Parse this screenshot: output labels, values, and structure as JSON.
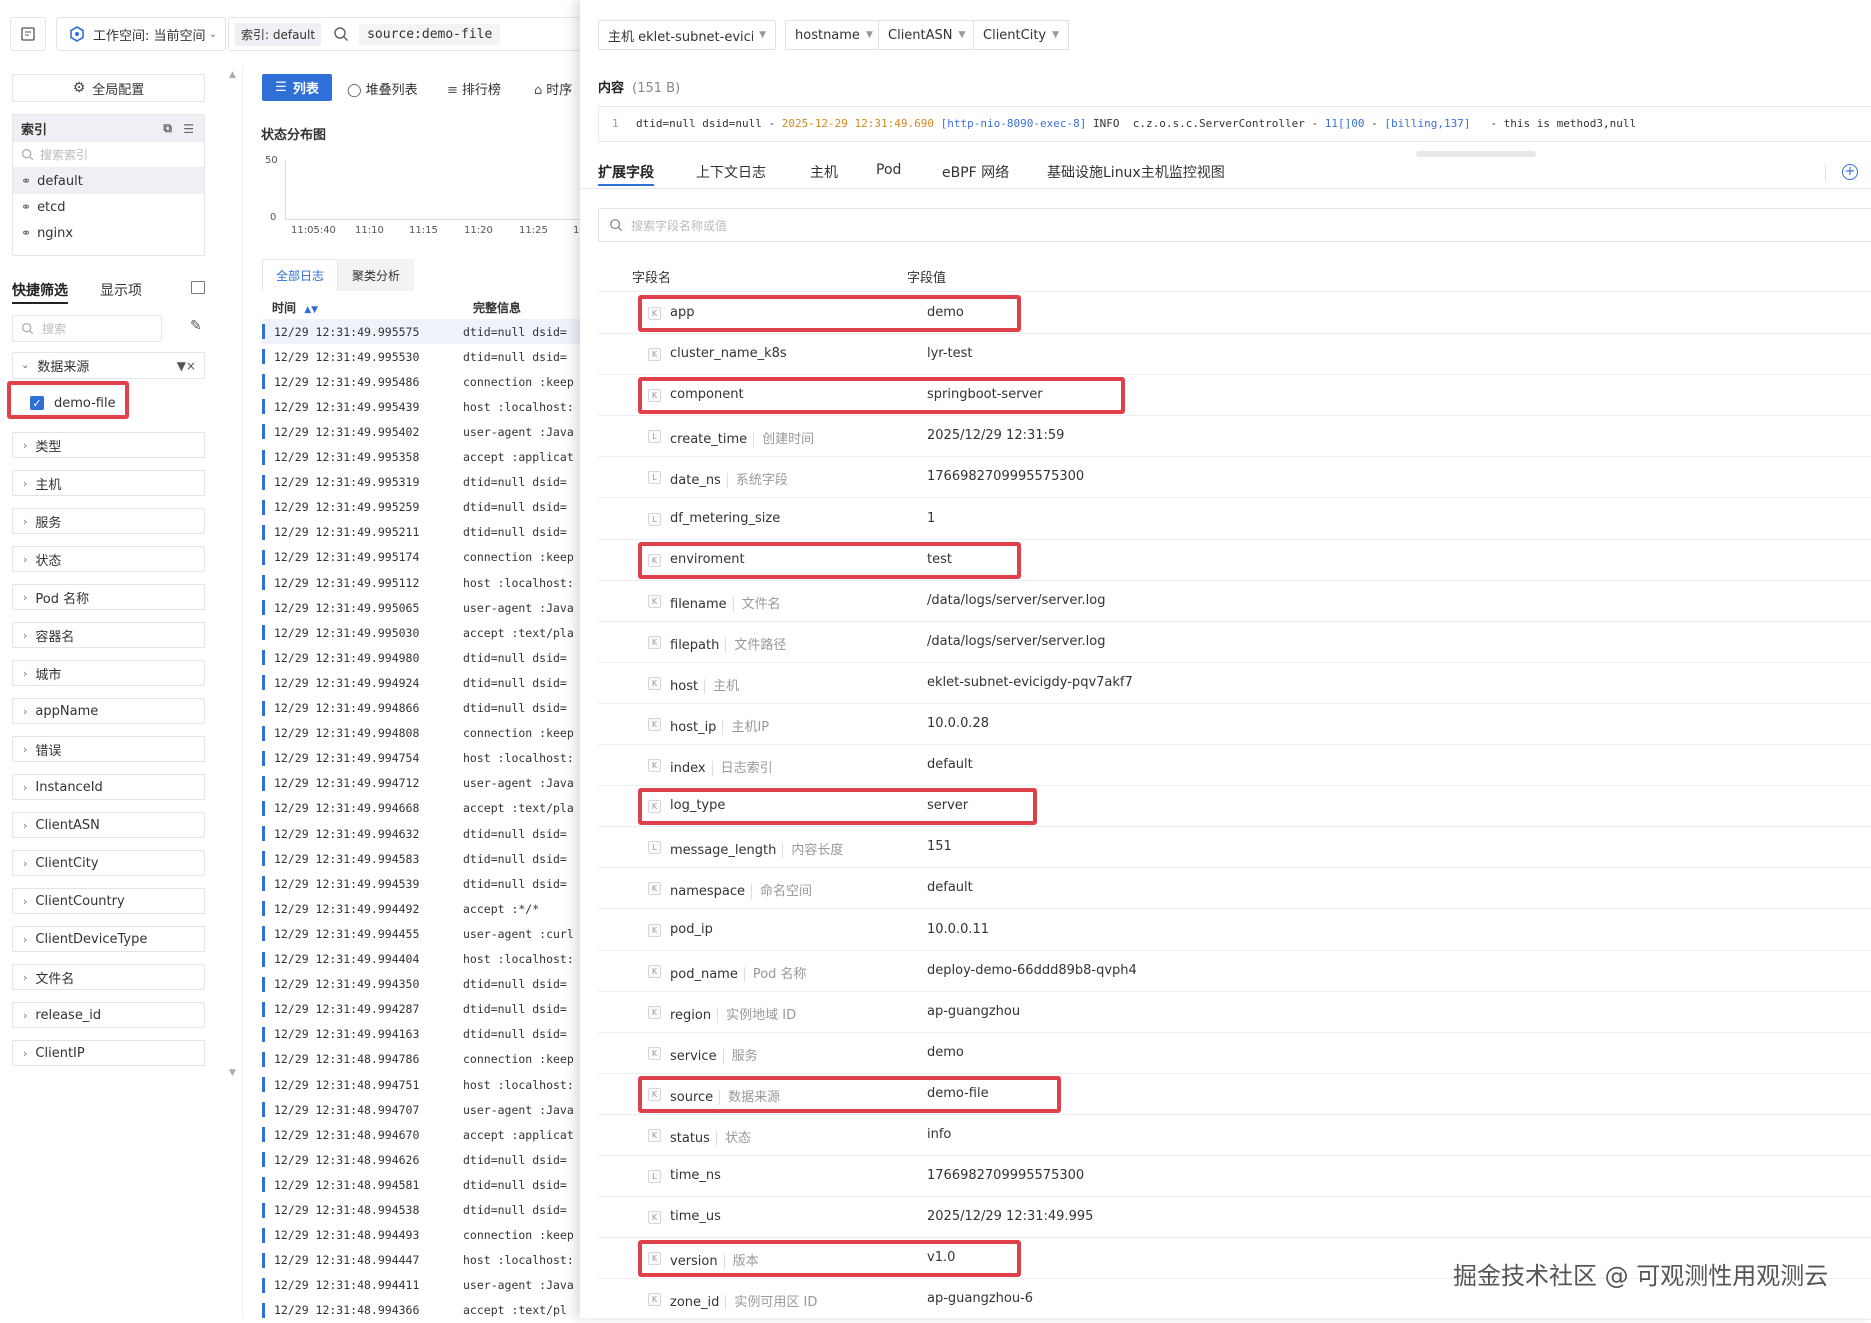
{
  "topbar": {
    "workspace_label": "工作空间: 当前空间",
    "index_chip": "索引: default",
    "query_text": "source:demo-file"
  },
  "sidebar": {
    "global_config": "全局配置",
    "index_title": "索引",
    "index_search_placeholder": "搜索索引",
    "indexes": [
      "default",
      "etcd",
      "nginx"
    ],
    "tab_quick_filter": "快捷筛选",
    "tab_display": "显示项",
    "search_placeholder": "搜索",
    "data_source_label": "数据来源",
    "data_source_value": "demo-file",
    "categories": [
      "类型",
      "主机",
      "服务",
      "状态",
      "Pod 名称",
      "容器名",
      "城市",
      "appName",
      "错误",
      "InstanceId",
      "ClientASN",
      "ClientCity",
      "ClientCountry",
      "ClientDeviceType",
      "文件名",
      "release_id",
      "ClientIP"
    ]
  },
  "middle": {
    "view_tabs": [
      "列表",
      "堆叠列表",
      "排行榜",
      "时序"
    ],
    "status_title": "状态分布图",
    "y_ticks": [
      "50",
      "0"
    ],
    "x_ticks": [
      "11:05:40",
      "11:10",
      "11:15",
      "11:20",
      "11:25",
      "1"
    ],
    "log_tabs": [
      "全部日志",
      "聚类分析"
    ],
    "col_time": "时间",
    "col_msg": "完整信息",
    "rows": [
      {
        "t": "12/29 12:31:49.995575",
        "m": "dtid=null dsid="
      },
      {
        "t": "12/29 12:31:49.995530",
        "m": "dtid=null dsid="
      },
      {
        "t": "12/29 12:31:49.995486",
        "m": "connection :keep"
      },
      {
        "t": "12/29 12:31:49.995439",
        "m": "host :localhost:"
      },
      {
        "t": "12/29 12:31:49.995402",
        "m": "user-agent :Java"
      },
      {
        "t": "12/29 12:31:49.995358",
        "m": "accept :applicat"
      },
      {
        "t": "12/29 12:31:49.995319",
        "m": "dtid=null dsid="
      },
      {
        "t": "12/29 12:31:49.995259",
        "m": "dtid=null dsid="
      },
      {
        "t": "12/29 12:31:49.995211",
        "m": "dtid=null dsid="
      },
      {
        "t": "12/29 12:31:49.995174",
        "m": "connection :keep"
      },
      {
        "t": "12/29 12:31:49.995112",
        "m": "host :localhost:"
      },
      {
        "t": "12/29 12:31:49.995065",
        "m": "user-agent :Java"
      },
      {
        "t": "12/29 12:31:49.995030",
        "m": "accept :text/pla"
      },
      {
        "t": "12/29 12:31:49.994980",
        "m": "dtid=null dsid="
      },
      {
        "t": "12/29 12:31:49.994924",
        "m": "dtid=null dsid="
      },
      {
        "t": "12/29 12:31:49.994866",
        "m": "dtid=null dsid="
      },
      {
        "t": "12/29 12:31:49.994808",
        "m": "connection :keep"
      },
      {
        "t": "12/29 12:31:49.994754",
        "m": "host :localhost:"
      },
      {
        "t": "12/29 12:31:49.994712",
        "m": "user-agent :Java"
      },
      {
        "t": "12/29 12:31:49.994668",
        "m": "accept :text/pla"
      },
      {
        "t": "12/29 12:31:49.994632",
        "m": "dtid=null dsid="
      },
      {
        "t": "12/29 12:31:49.994583",
        "m": "dtid=null dsid="
      },
      {
        "t": "12/29 12:31:49.994539",
        "m": "dtid=null dsid="
      },
      {
        "t": "12/29 12:31:49.994492",
        "m": "accept :*/*"
      },
      {
        "t": "12/29 12:31:49.994455",
        "m": "user-agent :curl"
      },
      {
        "t": "12/29 12:31:49.994404",
        "m": "host :localhost:"
      },
      {
        "t": "12/29 12:31:49.994350",
        "m": "dtid=null dsid="
      },
      {
        "t": "12/29 12:31:49.994287",
        "m": "dtid=null dsid="
      },
      {
        "t": "12/29 12:31:49.994163",
        "m": "dtid=null dsid="
      },
      {
        "t": "12/29 12:31:48.994786",
        "m": "connection :keep"
      },
      {
        "t": "12/29 12:31:48.994751",
        "m": "host :localhost:"
      },
      {
        "t": "12/29 12:31:48.994707",
        "m": "user-agent :Java"
      },
      {
        "t": "12/29 12:31:48.994670",
        "m": "accept :applicat"
      },
      {
        "t": "12/29 12:31:48.994626",
        "m": "dtid=null dsid="
      },
      {
        "t": "12/29 12:31:48.994581",
        "m": "dtid=null dsid="
      },
      {
        "t": "12/29 12:31:48.994538",
        "m": "dtid=null dsid="
      },
      {
        "t": "12/29 12:31:48.994493",
        "m": "connection :keep"
      },
      {
        "t": "12/29 12:31:48.994447",
        "m": "host :localhost:"
      },
      {
        "t": "12/29 12:31:48.994411",
        "m": "user-agent :Java"
      },
      {
        "t": "12/29 12:31:48.994366",
        "m": "accept :text/pl"
      }
    ]
  },
  "panel": {
    "chips": [
      "主机 eklet-subnet-evicigd...",
      "hostname",
      "ClientASN",
      "ClientCity"
    ],
    "content_label": "内容",
    "content_size": "(151 B)",
    "line_no": "1",
    "content_parts": [
      {
        "text": "dtid=null dsid=null - ",
        "color": "#333333"
      },
      {
        "text": "2025-12-29 12:31:49.690",
        "color": "#d08a1e"
      },
      {
        "text": " [http-nio-8090-exec-8]",
        "color": "#3a6fd8"
      },
      {
        "text": " INFO  c.z.o.s.c.ServerController - ",
        "color": "#333333"
      },
      {
        "text": "11[]00",
        "color": "#3a6fd8"
      },
      {
        "text": " - ",
        "color": "#333333"
      },
      {
        "text": "[billing,137]",
        "color": "#3a6fd8"
      },
      {
        "text": "   - this is method3,null",
        "color": "#333333"
      }
    ],
    "tabs": [
      "扩展字段",
      "上下文日志",
      "主机",
      "Pod",
      "eBPF 网络",
      "基础设施Linux主机监控视图"
    ],
    "field_search_placeholder": "搜索字段名称或值",
    "col_name": "字段名",
    "col_value": "字段值",
    "fields": [
      {
        "k": "K",
        "name": "app",
        "desc": "",
        "value": "demo",
        "hl": true
      },
      {
        "k": "K",
        "name": "cluster_name_k8s",
        "desc": "",
        "value": "lyr-test",
        "hl": false
      },
      {
        "k": "K",
        "name": "component",
        "desc": "",
        "value": "springboot-server",
        "hl": true
      },
      {
        "k": "L",
        "name": "create_time",
        "desc": "创建时间",
        "value": "2025/12/29 12:31:59",
        "hl": false
      },
      {
        "k": "L",
        "name": "date_ns",
        "desc": "系统字段",
        "value": "1766982709995575300",
        "hl": false
      },
      {
        "k": "L",
        "name": "df_metering_size",
        "desc": "",
        "value": "1",
        "hl": false
      },
      {
        "k": "K",
        "name": "enviroment",
        "desc": "",
        "value": "test",
        "hl": true
      },
      {
        "k": "K",
        "name": "filename",
        "desc": "文件名",
        "value": "/data/logs/server/server.log",
        "hl": false
      },
      {
        "k": "K",
        "name": "filepath",
        "desc": "文件路径",
        "value": "/data/logs/server/server.log",
        "hl": false
      },
      {
        "k": "K",
        "name": "host",
        "desc": "主机",
        "value": "eklet-subnet-evicigdy-pqv7akf7",
        "hl": false
      },
      {
        "k": "K",
        "name": "host_ip",
        "desc": "主机IP",
        "value": "10.0.0.28",
        "hl": false
      },
      {
        "k": "K",
        "name": "index",
        "desc": "日志索引",
        "value": "default",
        "hl": false
      },
      {
        "k": "K",
        "name": "log_type",
        "desc": "",
        "value": "server",
        "hl": true
      },
      {
        "k": "L",
        "name": "message_length",
        "desc": "内容长度",
        "value": "151",
        "hl": false
      },
      {
        "k": "K",
        "name": "namespace",
        "desc": "命名空间",
        "value": "default",
        "hl": false
      },
      {
        "k": "K",
        "name": "pod_ip",
        "desc": "",
        "value": "10.0.0.11",
        "hl": false
      },
      {
        "k": "K",
        "name": "pod_name",
        "desc": "Pod 名称",
        "value": "deploy-demo-66ddd89b8-qvph4",
        "hl": false
      },
      {
        "k": "K",
        "name": "region",
        "desc": "实例地域 ID",
        "value": "ap-guangzhou",
        "hl": false
      },
      {
        "k": "K",
        "name": "service",
        "desc": "服务",
        "value": "demo",
        "hl": false
      },
      {
        "k": "K",
        "name": "source",
        "desc": "数据来源",
        "value": "demo-file",
        "hl": true
      },
      {
        "k": "K",
        "name": "status",
        "desc": "状态",
        "value": "info",
        "hl": false
      },
      {
        "k": "L",
        "name": "time_ns",
        "desc": "",
        "value": "1766982709995575300",
        "hl": false
      },
      {
        "k": "K",
        "name": "time_us",
        "desc": "",
        "value": "2025/12/29 12:31:49.995",
        "hl": false
      },
      {
        "k": "K",
        "name": "version",
        "desc": "版本",
        "value": "v1.0",
        "hl": true
      },
      {
        "k": "K",
        "name": "zone_id",
        "desc": "实例可用区 ID",
        "value": "ap-guangzhou-6",
        "hl": false
      }
    ]
  },
  "watermark": "掘金技术社区 @ 可观测性用观测云",
  "colors": {
    "accent": "#2f6fd8",
    "highlight": "#e0404a"
  }
}
